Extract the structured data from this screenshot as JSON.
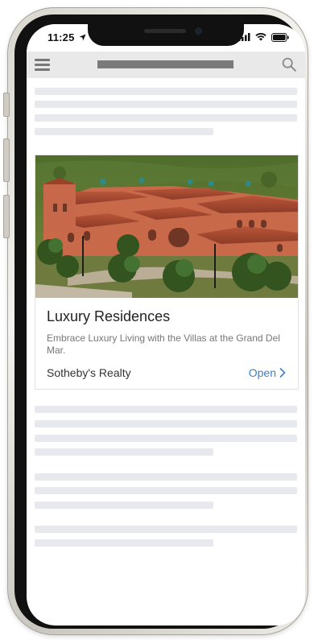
{
  "status_bar": {
    "time": "11:25",
    "icons": [
      "location-arrow-icon",
      "signal-icon",
      "wifi-icon",
      "battery-icon"
    ]
  },
  "app_header": {
    "menu_icon": "hamburger-menu-icon",
    "search_icon": "search-icon"
  },
  "card": {
    "image_description": "",
    "title": "Luxury Residences",
    "description": "Embrace Luxury Living with the Villas at the Grand Del Mar.",
    "source": "Sotheby's Realty",
    "cta_label": "Open",
    "cta_icon": "chevron-right-icon",
    "accent_color": "#3f7fc4"
  },
  "colors": {
    "placeholder": "#e8e9ee",
    "header_bg": "#e9e9e9",
    "header_title_placeholder": "#7a7a7a"
  }
}
